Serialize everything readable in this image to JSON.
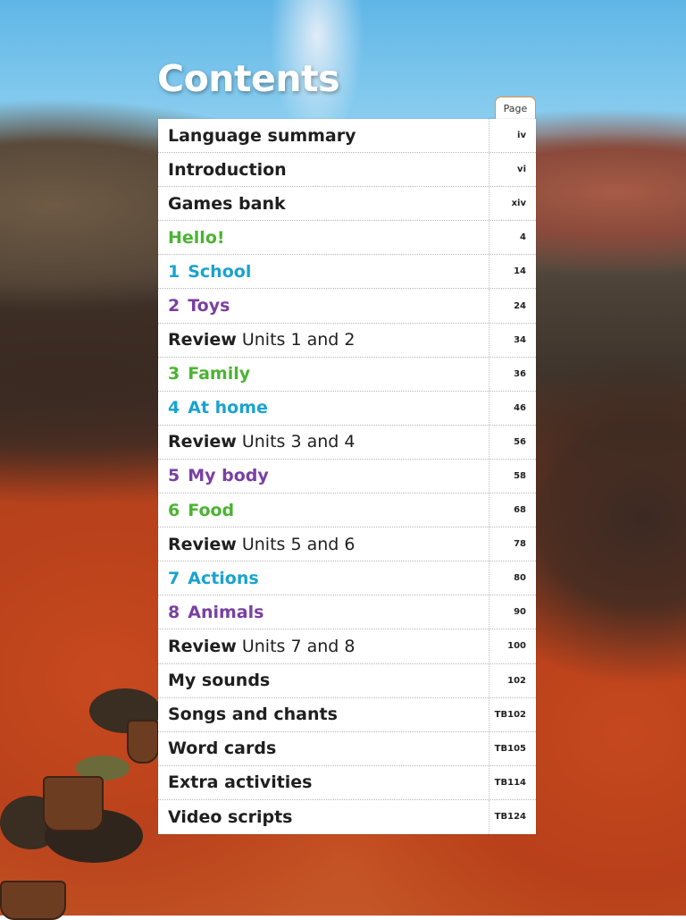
{
  "title": "Contents",
  "page_header": "Page",
  "colors": {
    "default": "#1f1f1f",
    "green": "#4bb432",
    "blue": "#1aa3cf",
    "purple": "#7a3fa0"
  },
  "entries": [
    {
      "num": "",
      "text": "Language summary",
      "rest": "",
      "color": "default",
      "page": "iv"
    },
    {
      "num": "",
      "text": "Introduction",
      "rest": "",
      "color": "default",
      "page": "vi"
    },
    {
      "num": "",
      "text": "Games bank",
      "rest": "",
      "color": "default",
      "page": "xiv"
    },
    {
      "num": "",
      "text": "Hello!",
      "rest": "",
      "color": "green",
      "page": "4"
    },
    {
      "num": "1",
      "text": "School",
      "rest": "",
      "color": "blue",
      "page": "14"
    },
    {
      "num": "2",
      "text": "Toys",
      "rest": "",
      "color": "purple",
      "page": "24"
    },
    {
      "num": "",
      "text": "Review",
      "rest": "Units 1 and 2",
      "color": "default",
      "page": "34"
    },
    {
      "num": "3",
      "text": "Family",
      "rest": "",
      "color": "green",
      "page": "36"
    },
    {
      "num": "4",
      "text": "At home",
      "rest": "",
      "color": "blue",
      "page": "46"
    },
    {
      "num": "",
      "text": "Review",
      "rest": "Units 3 and 4",
      "color": "default",
      "page": "56"
    },
    {
      "num": "5",
      "text": "My body",
      "rest": "",
      "color": "purple",
      "page": "58"
    },
    {
      "num": "6",
      "text": "Food",
      "rest": "",
      "color": "green",
      "page": "68"
    },
    {
      "num": "",
      "text": "Review",
      "rest": "Units 5 and 6",
      "color": "default",
      "page": "78"
    },
    {
      "num": "7",
      "text": "Actions",
      "rest": "",
      "color": "blue",
      "page": "80"
    },
    {
      "num": "8",
      "text": "Animals",
      "rest": "",
      "color": "purple",
      "page": "90"
    },
    {
      "num": "",
      "text": "Review",
      "rest": "Units 7 and 8",
      "color": "default",
      "page": "100"
    },
    {
      "num": "",
      "text": "My sounds",
      "rest": "",
      "color": "default",
      "page": "102"
    },
    {
      "num": "",
      "text": "Songs and chants",
      "rest": "",
      "color": "default",
      "page": "TB102"
    },
    {
      "num": "",
      "text": "Word cards",
      "rest": "",
      "color": "default",
      "page": "TB105"
    },
    {
      "num": "",
      "text": "Extra activities",
      "rest": "",
      "color": "default",
      "page": "TB114"
    },
    {
      "num": "",
      "text": "Video scripts",
      "rest": "",
      "color": "default",
      "page": "TB124"
    }
  ]
}
